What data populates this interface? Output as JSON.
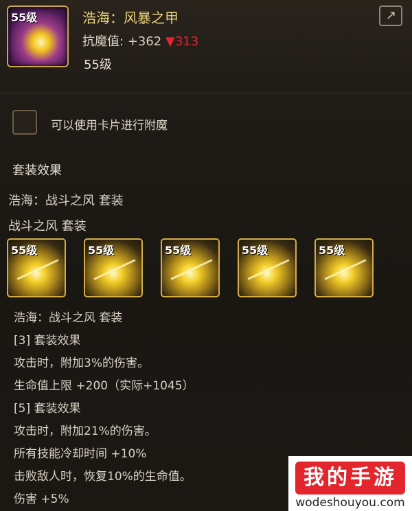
{
  "item": {
    "level_badge": "55级",
    "name": "浩海：风暴之甲",
    "stat_label": "抗魔值:",
    "stat_value": "+362",
    "stat_delta_icon": "▼",
    "stat_delta": "313",
    "level": "55级"
  },
  "share": {
    "icon": "share-icon",
    "glyph": "↗"
  },
  "enchant": {
    "label": "可以使用卡片进行附魔"
  },
  "set": {
    "title": "套装效果",
    "set_name_full": "浩海：战斗之风 套装",
    "set_name_short": "战斗之风 套装",
    "pieces": [
      {
        "level": "55级"
      },
      {
        "level": "55级"
      },
      {
        "level": "55级"
      },
      {
        "level": "55级"
      },
      {
        "level": "55级"
      }
    ],
    "lines": [
      "浩海：战斗之风 套装",
      "[3] 套装效果",
      "攻击时，附加3%的伤害。",
      "生命值上限 +200（实际+1045）",
      "[5] 套装效果",
      "攻击时，附加21%的伤害。",
      "所有技能冷却时间 +10%",
      "击败敌人时，恢复10%的生命值。",
      "伤害 +5%"
    ]
  },
  "watermark": {
    "brand": "我的手游",
    "url": "wodeshouyou.com"
  },
  "colors": {
    "gold_text": "#ecd37a",
    "down_red": "#e0262e",
    "brand_red": "#e3262e"
  }
}
